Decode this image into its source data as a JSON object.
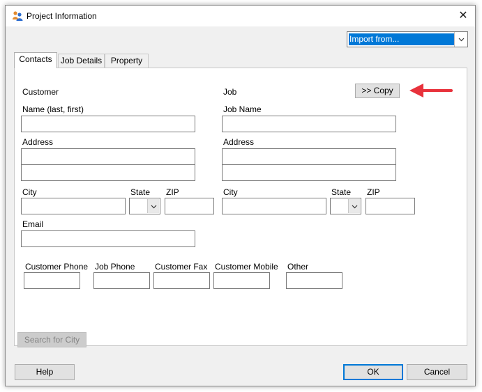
{
  "window": {
    "title": "Project Information",
    "close_glyph": "✕",
    "icon": "people-icon"
  },
  "import": {
    "selected": "Import from..."
  },
  "tabs": [
    {
      "label": "Contacts",
      "active": true
    },
    {
      "label": "Job Details",
      "active": false
    },
    {
      "label": "Property",
      "active": false
    }
  ],
  "copy_button": {
    "label": ">> Copy"
  },
  "annotation": {
    "color": "#e8323c",
    "icon": "arrow-left-icon"
  },
  "customer": {
    "section_label": "Customer",
    "name_label": "Name (last, first)",
    "name_value": "",
    "address_label": "Address",
    "address_line1": "",
    "address_line2": "",
    "city_label": "City",
    "city_value": "",
    "state_label": "State",
    "state_value": "",
    "zip_label": "ZIP",
    "zip_value": "",
    "email_label": "Email",
    "email_value": ""
  },
  "job": {
    "section_label": "Job",
    "name_label": "Job Name",
    "name_value": "",
    "address_label": "Address",
    "address_line1": "",
    "address_line2": "",
    "city_label": "City",
    "city_value": "",
    "state_label": "State",
    "state_value": "",
    "zip_label": "ZIP",
    "zip_value": ""
  },
  "phones": [
    {
      "label": "Customer Phone",
      "value": ""
    },
    {
      "label": "Job Phone",
      "value": ""
    },
    {
      "label": "Customer Fax",
      "value": ""
    },
    {
      "label": "Customer Mobile",
      "value": ""
    },
    {
      "label": "Other",
      "value": ""
    }
  ],
  "search_button": {
    "label": "Search for City",
    "enabled": false
  },
  "footer": {
    "help": "Help",
    "ok": "OK",
    "cancel": "Cancel"
  },
  "colors": {
    "accent": "#0078d7",
    "dialog_bg": "#f0f0f0"
  }
}
